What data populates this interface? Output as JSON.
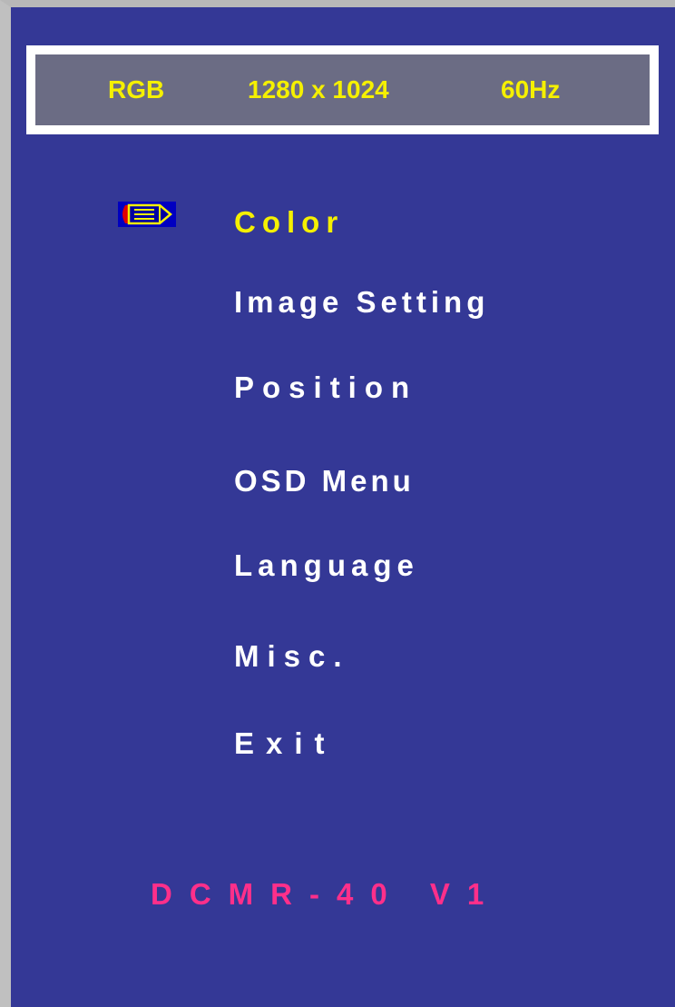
{
  "signal": {
    "mode": "RGB",
    "resolution": "1280 x 1024",
    "frequency": "60Hz"
  },
  "menu": {
    "selected_index": 0,
    "selector_icon": "pencil-pointer-icon",
    "items": [
      {
        "label": "Color"
      },
      {
        "label": "Image Setting"
      },
      {
        "label": "Position"
      },
      {
        "label": "OSD Menu"
      },
      {
        "label": "Language"
      },
      {
        "label": "Misc."
      },
      {
        "label": "Exit"
      }
    ]
  },
  "footer": {
    "version": "DCMR-40 V1"
  },
  "colors": {
    "background": "#343896",
    "highlight": "#f5f000",
    "menu_text": "#ffffff",
    "version_text": "#ff2f8a",
    "signal_bar": "#6b6c84"
  }
}
